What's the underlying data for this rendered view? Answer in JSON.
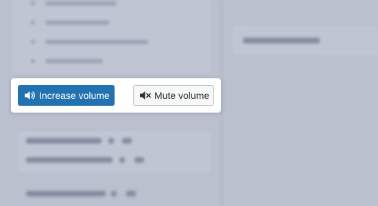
{
  "toolbar": {
    "increase_label": "Increase volume",
    "mute_label": "Mute volume"
  },
  "icons": {
    "increase": "volume-up-icon",
    "mute": "volume-mute-icon"
  },
  "colors": {
    "primary": "#2271b1",
    "secondary_bg": "#f6f7f7"
  }
}
